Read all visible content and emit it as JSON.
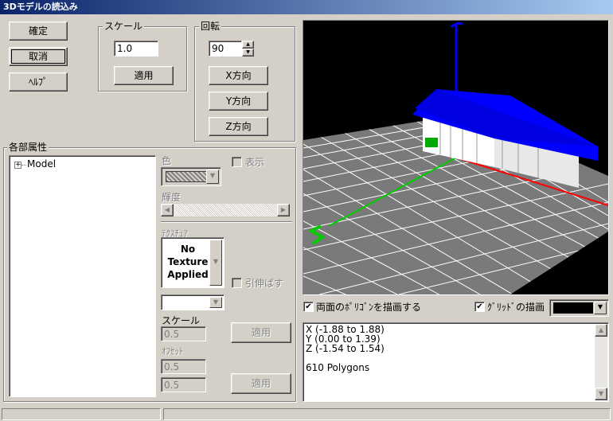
{
  "window": {
    "title": "3Dモデルの読込み"
  },
  "buttons": {
    "ok": "確定",
    "cancel": "取消",
    "help": "ﾍﾙﾌﾟ"
  },
  "scale": {
    "label": "スケール",
    "value": "1.0",
    "apply": "適用"
  },
  "rotation": {
    "label": "回転",
    "value": "90",
    "x": "X方向",
    "y": "Y方向",
    "z": "Z方向"
  },
  "parts": {
    "label": "各部属性",
    "tree_root": "Model",
    "color_label": "色",
    "show_label": "表示",
    "brightness_label": "輝度",
    "texture_label": "ﾃｸｽﾁｭｱ",
    "texture_preview": "No\nTexture\nApplied",
    "stretch_label": "引伸ばす",
    "scale_label": "スケール",
    "scale_value": "0.5",
    "scale_apply": "適用",
    "offset_label": "ｵﾌｾｯﾄ",
    "offset_x": "0.5",
    "offset_y": "0.5",
    "offset_apply": "適用"
  },
  "view_options": {
    "double_sided": "両面のﾎﾟﾘｺﾞﾝを描画する",
    "grid": "ｸﾞﾘｯﾄﾞの描画",
    "grid_color": "#000000"
  },
  "info": {
    "x_range": "X (-1.88 to 1.88)",
    "y_range": "Y (0.00 to 1.39)",
    "z_range": "Z (-1.54 to 1.54)",
    "polygons": "610 Polygons"
  },
  "colors": {
    "roof": "#0000ff",
    "x_axis": "#ff0000",
    "y_axis": "#0000ff",
    "z_axis": "#00cc00",
    "grid": "#ffffff"
  }
}
